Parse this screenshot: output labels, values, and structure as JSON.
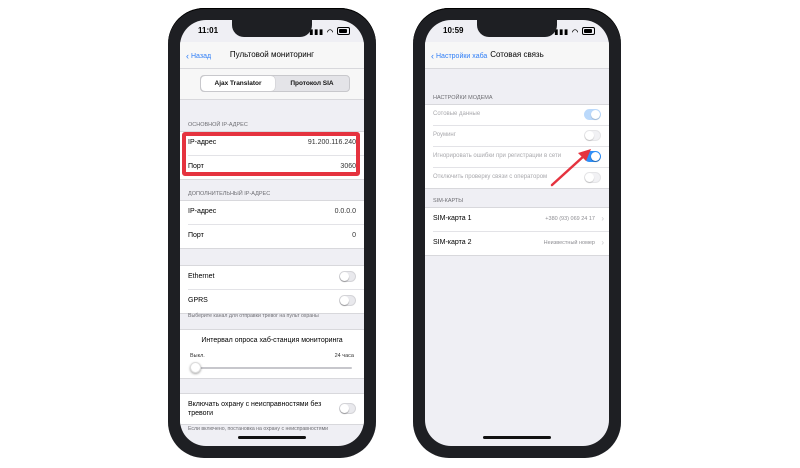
{
  "left_phone": {
    "status_time": "11:01",
    "back_label": "Назад",
    "title": "Пультовой мониторинг",
    "segments": [
      {
        "label": "Ajax Translator",
        "active": true
      },
      {
        "label": "Протокол SIA",
        "active": false
      }
    ],
    "primary_header": "ОСНОВНОЙ IP-АДРЕС",
    "primary_rows": [
      {
        "label": "IP-адрес",
        "value": "91.200.116.240"
      },
      {
        "label": "Порт",
        "value": "3060"
      }
    ],
    "secondary_header": "ДОПОЛНИТЕЛЬНЫЙ IP-АДРЕС",
    "secondary_rows": [
      {
        "label": "IP-адрес",
        "value": "0.0.0.0"
      },
      {
        "label": "Порт",
        "value": "0"
      }
    ],
    "channel_rows": [
      {
        "label": "Ethernet",
        "on": false
      },
      {
        "label": "GPRS",
        "on": false
      }
    ],
    "channel_note": "Выберите канал для отправки тревог на пульт охраны",
    "slider": {
      "title": "Интервал опроса хаб-станция мониторинга",
      "min_label": "Выкл.",
      "max_label": "24 часа",
      "level": 0
    },
    "malfunction_row": {
      "label": "Включать охрану с неисправностями без тревоги",
      "on": false
    },
    "malfunction_note": "Если включено, постановка на охрану с неисправностями"
  },
  "right_phone": {
    "status_time": "10:59",
    "back_label": "Настройки хаба",
    "title": "Сотовая связь",
    "modem_header": "НАСТРОЙКИ МОДЕМА",
    "modem_rows": [
      {
        "label": "Сотовые данные",
        "on": true,
        "dim": true
      },
      {
        "label": "Роуминг",
        "on": false,
        "dim": true
      },
      {
        "label": "Игнорировать ошибки при регистрации в сети",
        "on": true,
        "dim": true
      },
      {
        "label": "Отключить проверку связи с оператором",
        "on": false,
        "dim": true
      }
    ],
    "sim_header": "SIM-КАРТЫ",
    "sim_rows": [
      {
        "label": "SIM-карта 1",
        "value": "+380 (93) 069 24 17"
      },
      {
        "label": "SIM-карта 2",
        "value": "Неизвестный номер"
      }
    ]
  },
  "colors": {
    "accent": "#2f8ff7",
    "highlight": "#e5333f",
    "frame": "#1e1f23",
    "background": "#efeff4"
  }
}
